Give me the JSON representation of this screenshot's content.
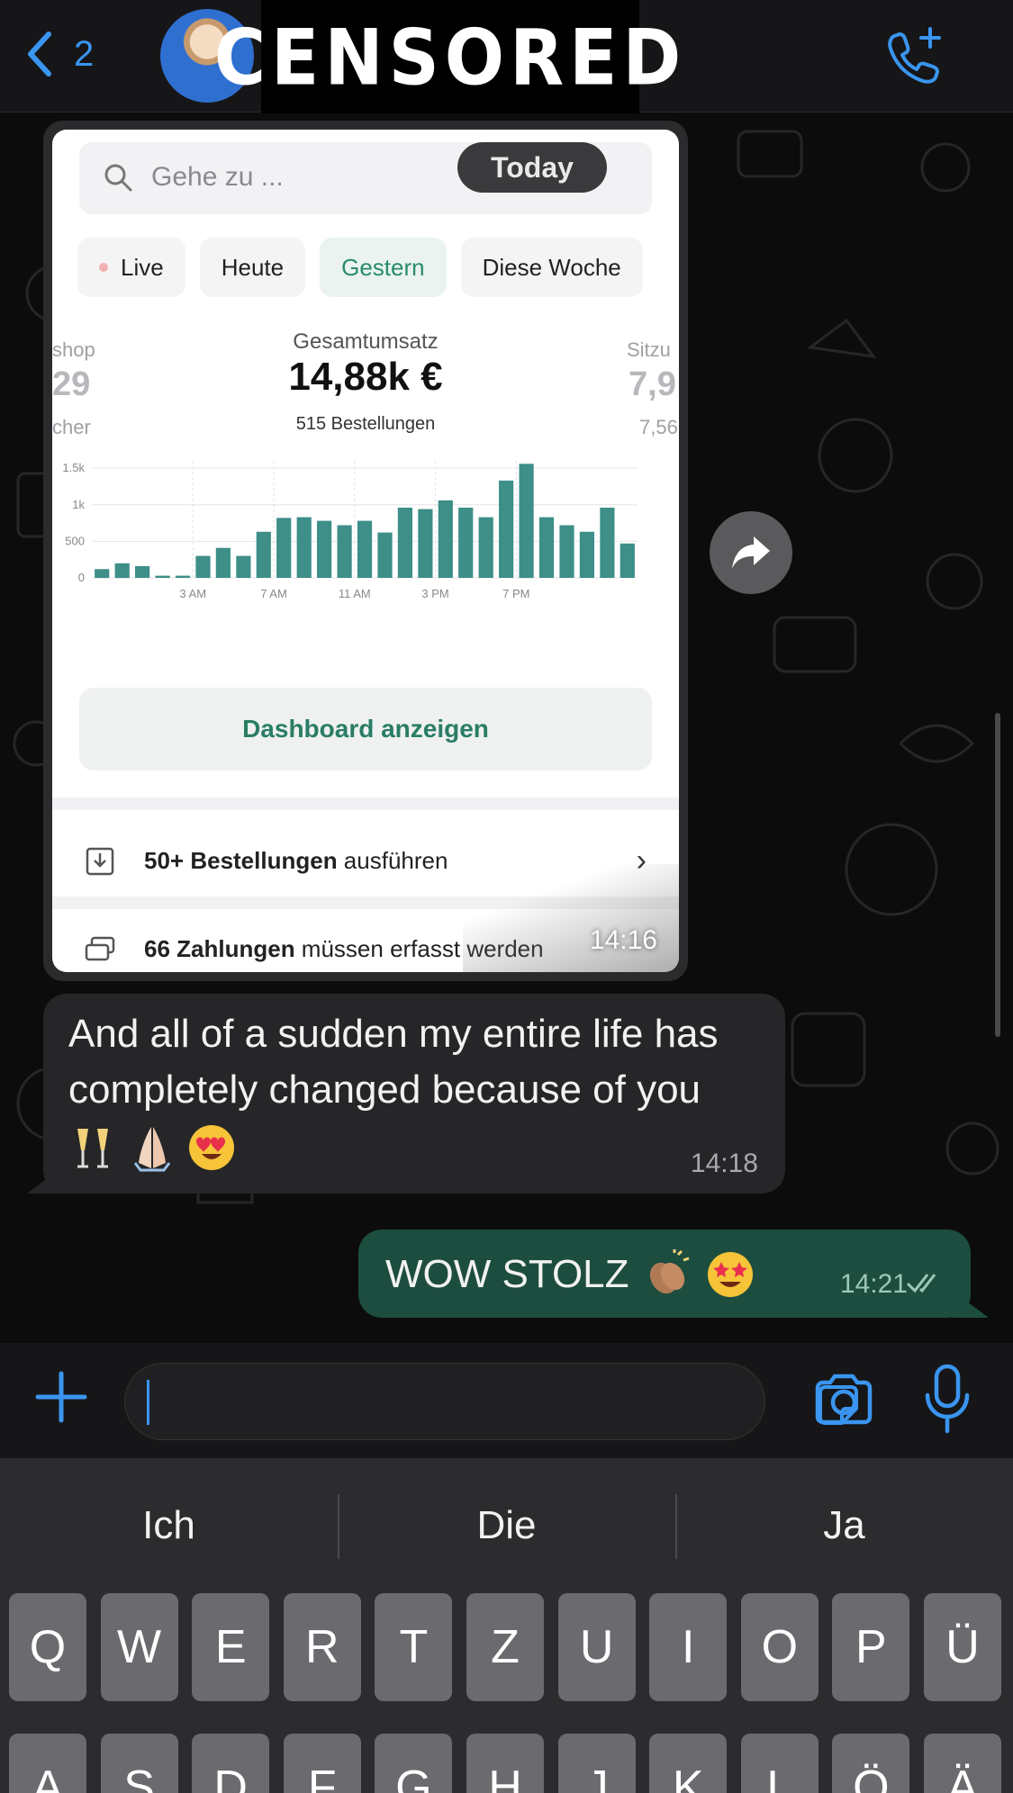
{
  "header": {
    "back_count": "2",
    "censored_label": "CENSORED"
  },
  "image_message": {
    "search_placeholder": "Gehe zu ...",
    "today_label": "Today",
    "chips": [
      {
        "label": "Live"
      },
      {
        "label": "Heute"
      },
      {
        "label": "Gestern"
      },
      {
        "label": "Diese Woche"
      }
    ],
    "left_stat": {
      "title": "shop",
      "value": "29",
      "sub": "cher"
    },
    "main_stat": {
      "title": "Gesamtumsatz",
      "value": "14,88k €",
      "sub": "515 Bestellungen"
    },
    "right_stat": {
      "title": "Sitzu",
      "value": "7,9",
      "sub": "7,56"
    },
    "dashboard_button": "Dashboard anzeigen",
    "row1": {
      "bold": "50+ Bestellungen",
      "rest": " ausführen"
    },
    "row2": {
      "bold": "66 Zahlungen",
      "rest": " müssen erfasst werden"
    },
    "time": "14:16"
  },
  "chart_data": {
    "type": "bar",
    "ylim": [
      0,
      1600
    ],
    "y_ticks": [
      "0",
      "500",
      "1k",
      "1.5k"
    ],
    "x_tick_labels": [
      "3 AM",
      "7 AM",
      "11 AM",
      "3 PM",
      "7 PM"
    ],
    "values": [
      120,
      200,
      160,
      30,
      30,
      300,
      410,
      300,
      630,
      820,
      830,
      780,
      720,
      780,
      620,
      960,
      940,
      1060,
      960,
      830,
      1330,
      1560,
      830,
      720,
      630,
      960,
      470
    ],
    "color": "#3d8f88"
  },
  "incoming": {
    "text": "And all of a sudden my entire life has completely changed because of you",
    "time": "14:18"
  },
  "outgoing": {
    "text": "WOW STOLZ",
    "time": "14:21"
  },
  "keyboard": {
    "suggestions": [
      "Ich",
      "Die",
      "Ja"
    ],
    "row1": [
      "Q",
      "W",
      "E",
      "R",
      "T",
      "Z",
      "U",
      "I",
      "O",
      "P",
      "Ü"
    ],
    "row2": [
      "A",
      "S",
      "D",
      "F",
      "G",
      "H",
      "J",
      "K",
      "L",
      "Ö",
      "Ä"
    ]
  },
  "colors": {
    "accent": "#3a95f0",
    "outgoing_bubble": "#1d4d3f",
    "incoming_bubble": "#262628",
    "chart_bar": "#3d8f88"
  }
}
